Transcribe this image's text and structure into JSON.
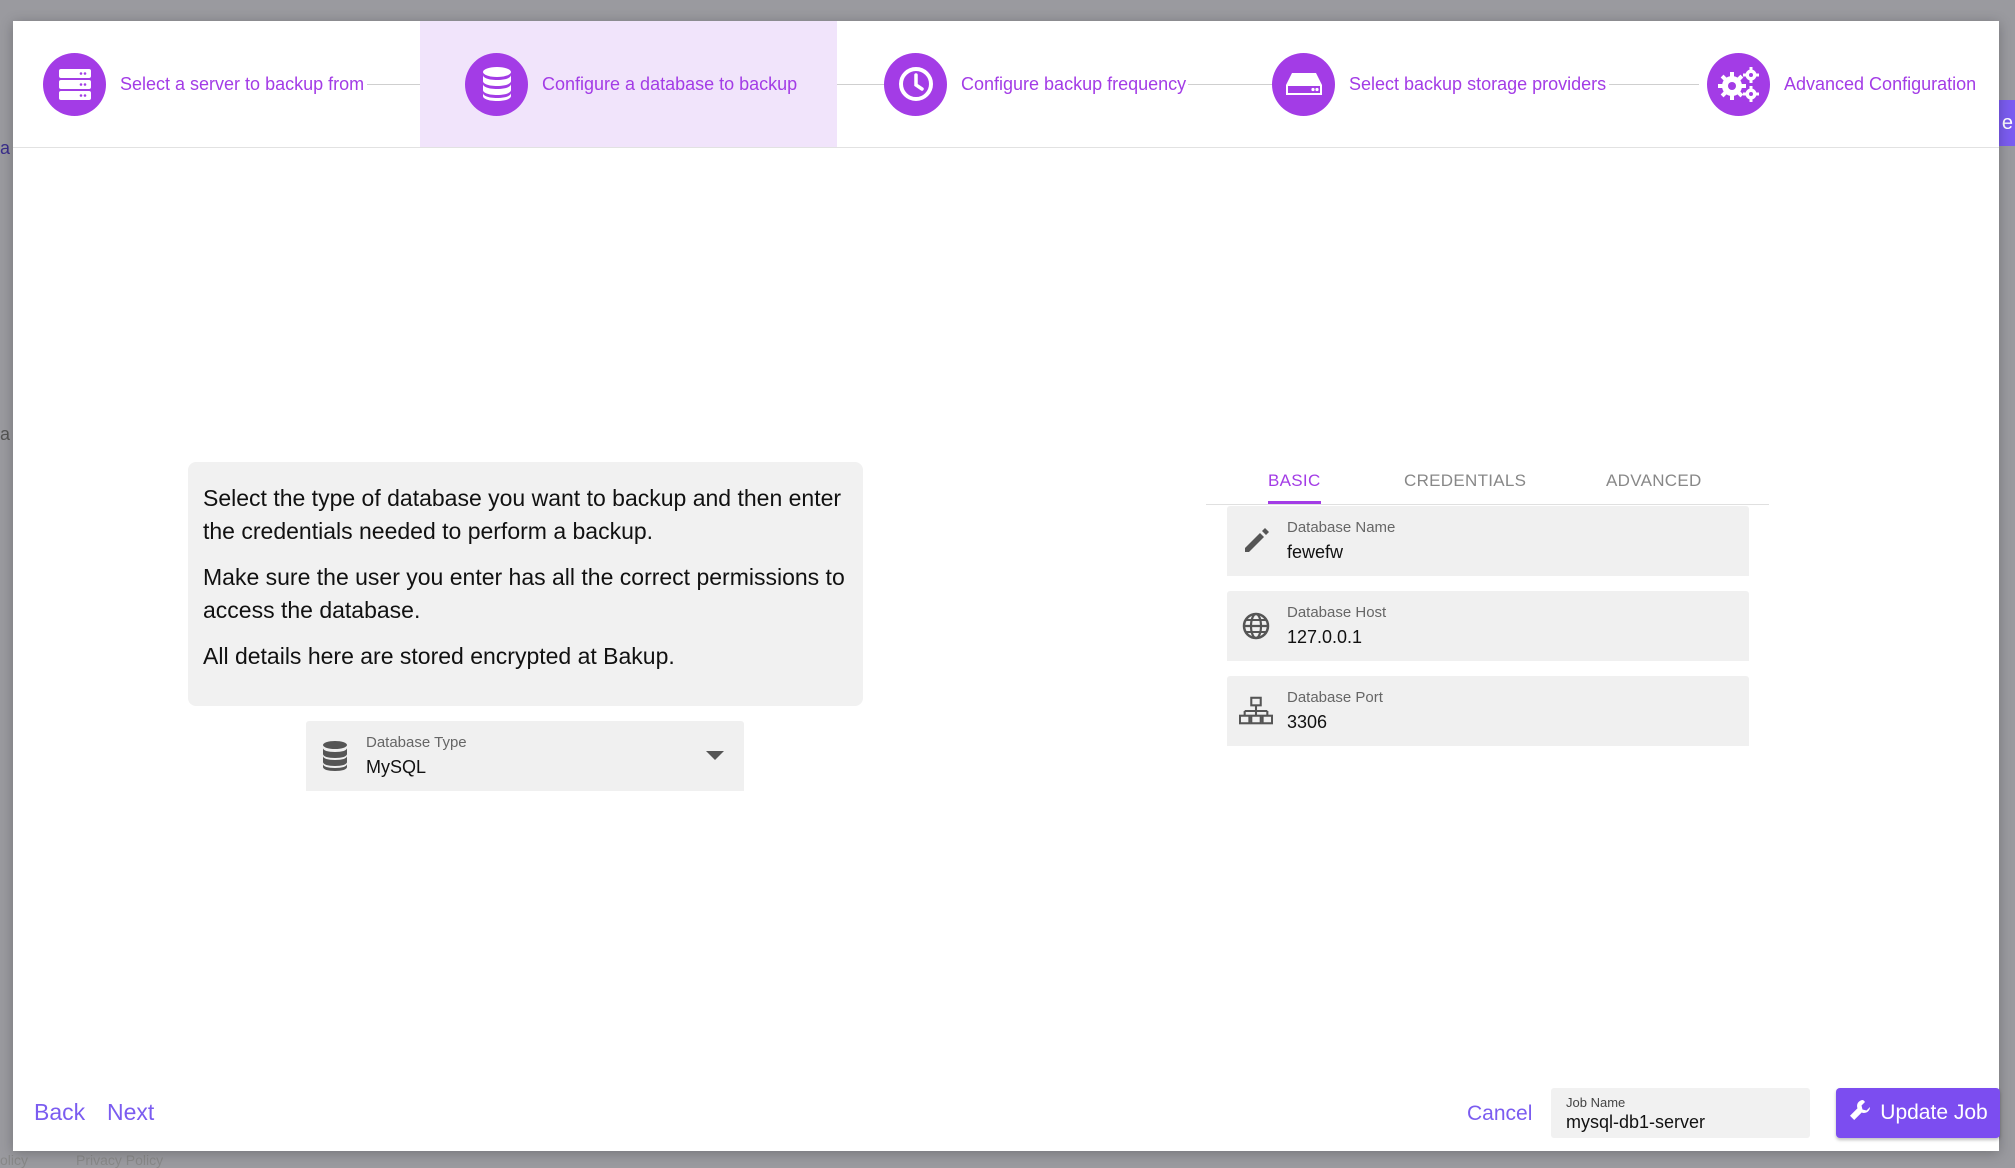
{
  "stepper": {
    "steps": [
      {
        "label": "Select a server to backup from",
        "icon": "server-icon",
        "active": false
      },
      {
        "label": "Configure a database to backup",
        "icon": "database-icon",
        "active": true
      },
      {
        "label": "Configure backup frequency",
        "icon": "clock-icon",
        "active": false
      },
      {
        "label": "Select backup storage providers",
        "icon": "storage-drive-icon",
        "active": false
      },
      {
        "label": "Advanced Configuration",
        "icon": "gears-icon",
        "active": false
      }
    ]
  },
  "info": {
    "paragraph1": "Select the type of database you want to backup and then enter the credentials needed to perform a backup.",
    "paragraph2": "Make sure the user you enter has all the correct permissions to access the database.",
    "paragraph3": "All details here are stored encrypted at Bakup."
  },
  "database_type": {
    "label": "Database Type",
    "value": "MySQL",
    "icon": "database-icon"
  },
  "tabs": {
    "basic": "BASIC",
    "credentials": "CREDENTIALS",
    "advanced": "ADVANCED",
    "active": "BASIC"
  },
  "fields": {
    "name": {
      "label": "Database Name",
      "value": "fewefw",
      "icon": "pencil-icon"
    },
    "host": {
      "label": "Database Host",
      "value": "127.0.0.1",
      "icon": "globe-icon"
    },
    "port": {
      "label": "Database Port",
      "value": "3306",
      "icon": "network-icon"
    }
  },
  "footer": {
    "back": "Back",
    "next": "Next",
    "cancel": "Cancel",
    "job_name_label": "Job Name",
    "job_name_value": "mysql-db1-server",
    "update": "Update Job"
  },
  "background": {
    "footer_left": "olicy",
    "footer_privacy": "Privacy Policy",
    "btn_fragment": "e",
    "frag1": "a",
    "frag2": "a"
  },
  "colors": {
    "accent": "#a33ce6",
    "primary_button": "#7c4df0",
    "link": "#7b5cf0",
    "active_step_bg": "#f1e4fb"
  }
}
